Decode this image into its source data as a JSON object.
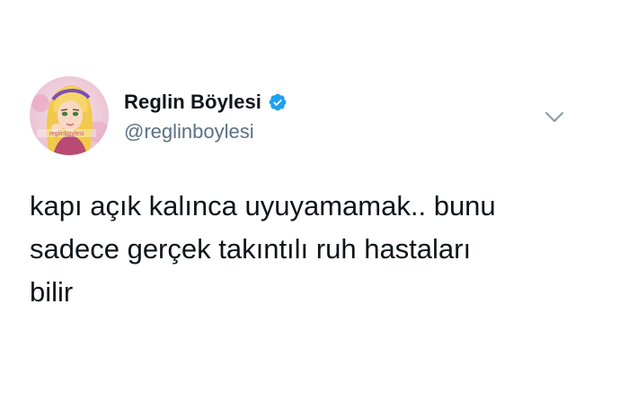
{
  "tweet": {
    "author": {
      "display_name": "Reglin Böylesi",
      "handle": "@reglinboylesi",
      "verified": true,
      "avatar_watermark": "reglinboylesi"
    },
    "text": "kapı açık kalınca uyuyamamak.. bunu\nsadece gerçek takıntılı ruh hastaları\nbilir"
  },
  "colors": {
    "verified_badge": "#1da1f2",
    "handle_text": "#5b7083",
    "body_text": "#0f1419",
    "chevron": "#8899a6"
  },
  "icons": {
    "verified": "verified-badge-icon",
    "menu": "chevron-down-icon"
  }
}
